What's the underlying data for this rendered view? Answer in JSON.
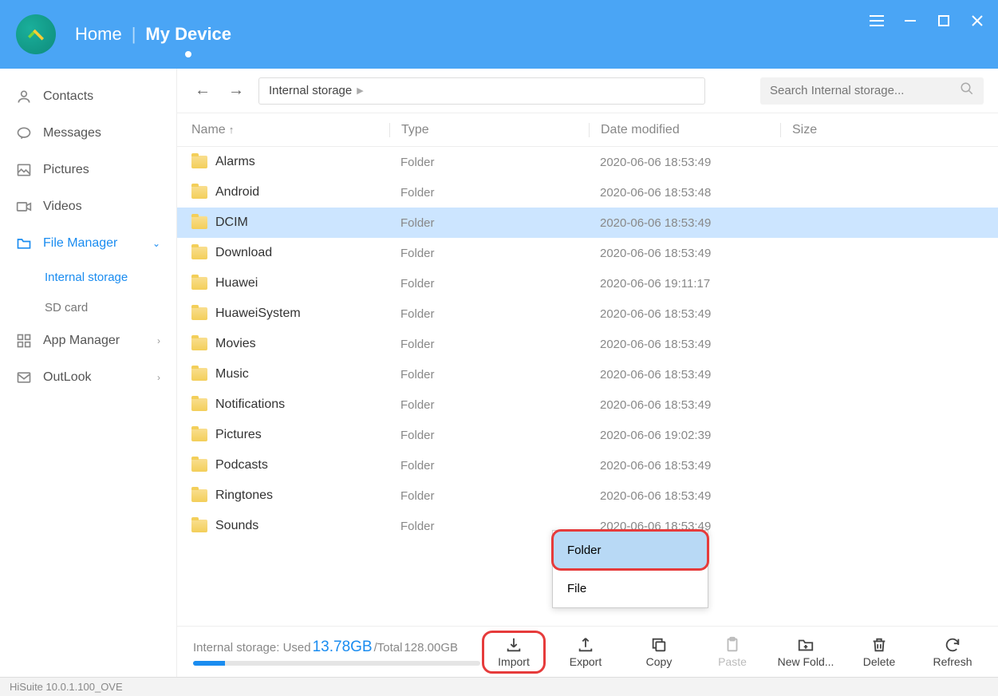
{
  "titlebar": {
    "tabs": [
      "Home",
      "My Device"
    ],
    "active_index": 1
  },
  "sidebar": {
    "items": [
      {
        "icon": "contacts",
        "label": "Contacts"
      },
      {
        "icon": "messages",
        "label": "Messages"
      },
      {
        "icon": "pictures",
        "label": "Pictures"
      },
      {
        "icon": "videos",
        "label": "Videos"
      },
      {
        "icon": "folder",
        "label": "File Manager",
        "active": true,
        "expandable": "down",
        "subs": [
          {
            "label": "Internal storage",
            "active": true
          },
          {
            "label": "SD card"
          }
        ]
      },
      {
        "icon": "grid",
        "label": "App Manager",
        "expandable": "right"
      },
      {
        "icon": "mail",
        "label": "OutLook",
        "expandable": "right"
      }
    ]
  },
  "toolbar": {
    "breadcrumb": "Internal storage",
    "search_placeholder": "Search Internal storage..."
  },
  "columns": {
    "name": "Name",
    "type": "Type",
    "date": "Date modified",
    "size": "Size",
    "sort": "↑"
  },
  "rows": [
    {
      "name": "Alarms",
      "type": "Folder",
      "date": "2020-06-06 18:53:49"
    },
    {
      "name": "Android",
      "type": "Folder",
      "date": "2020-06-06 18:53:48"
    },
    {
      "name": "DCIM",
      "type": "Folder",
      "date": "2020-06-06 18:53:49",
      "selected": true
    },
    {
      "name": "Download",
      "type": "Folder",
      "date": "2020-06-06 18:53:49"
    },
    {
      "name": "Huawei",
      "type": "Folder",
      "date": "2020-06-06 19:11:17"
    },
    {
      "name": "HuaweiSystem",
      "type": "Folder",
      "date": "2020-06-06 18:53:49"
    },
    {
      "name": "Movies",
      "type": "Folder",
      "date": "2020-06-06 18:53:49"
    },
    {
      "name": "Music",
      "type": "Folder",
      "date": "2020-06-06 18:53:49"
    },
    {
      "name": "Notifications",
      "type": "Folder",
      "date": "2020-06-06 18:53:49"
    },
    {
      "name": "Pictures",
      "type": "Folder",
      "date": "2020-06-06 19:02:39"
    },
    {
      "name": "Podcasts",
      "type": "Folder",
      "date": "2020-06-06 18:53:49"
    },
    {
      "name": "Ringtones",
      "type": "Folder",
      "date": "2020-06-06 18:53:49"
    },
    {
      "name": "Sounds",
      "type": "Folder",
      "date": "2020-06-06 18:53:49"
    }
  ],
  "popup": {
    "items": [
      "Folder",
      "File"
    ],
    "highlighted": 0
  },
  "storage": {
    "prefix": "Internal storage: Used ",
    "used": "13.78GB",
    "total_prefix": "/Total ",
    "total": "128.00GB",
    "percent": 11
  },
  "actions": [
    {
      "id": "import",
      "label": "Import",
      "icon": "import",
      "hl": true
    },
    {
      "id": "export",
      "label": "Export",
      "icon": "export"
    },
    {
      "id": "copy",
      "label": "Copy",
      "icon": "copy"
    },
    {
      "id": "paste",
      "label": "Paste",
      "icon": "paste",
      "disabled": true
    },
    {
      "id": "newfolder",
      "label": "New Fold...",
      "icon": "newfolder"
    },
    {
      "id": "delete",
      "label": "Delete",
      "icon": "delete"
    },
    {
      "id": "refresh",
      "label": "Refresh",
      "icon": "refresh"
    }
  ],
  "statusbar": "HiSuite 10.0.1.100_OVE"
}
